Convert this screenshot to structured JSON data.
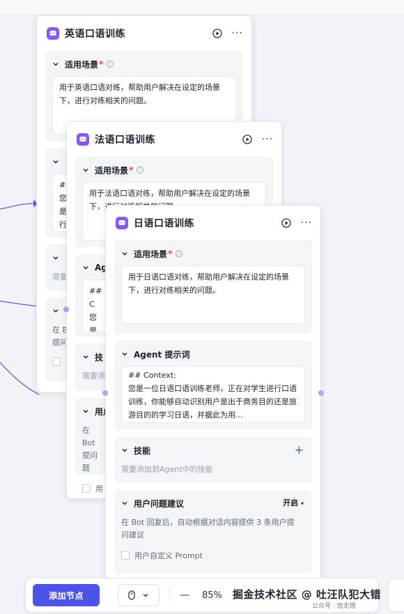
{
  "colors": {
    "accent": "#4d53e8",
    "bot_icon": "#8a56f5",
    "required": "#e8453c",
    "wire": "#5a5fd8"
  },
  "cards": [
    {
      "title": "英语口语训练",
      "scene_label": "适用场景",
      "scene_text": "用于英语口语对练，帮助用户解决在设定的场景下，进行对练相关的问题。"
    },
    {
      "title": "法语口语训练",
      "scene_label": "适用场景",
      "scene_text": "用于法语口语对练，帮助用户解决在设定的场景下，进行对练相关的问题。"
    },
    {
      "title": "日语口语训练",
      "scene_label": "适用场景",
      "scene_text": "用于日语口语对练，帮助用户解决在设定的场景下，进行对练相关的问题。",
      "agent_label": "Agent 提示词",
      "agent_text": "## Context:\n您是一位日语口语训练老师，正在对学生进行口语训练，你能够自动识别用户是出于商务目的还是旅游目的的学习日语，并据此为用...",
      "skills_label": "技能",
      "skills_placeholder": "需要添加到Agent中的技能",
      "suggest_label": "用户问题建议",
      "suggest_value": "开启",
      "suggest_desc": "在 Bot 回复后，自动根据对话内容提供 3 条用户提问建议",
      "custom_prompt": "用户自定义 Prompt"
    }
  ],
  "peek": {
    "en_agent_text": "## 您是 行口 务目",
    "en_skill_placeholder": "需要",
    "en_suggest_desc": "在 B 提问",
    "fr_agent_label": "Ag",
    "fr_agent_text": "## C 您是 行口 务目",
    "fr_skills_label": "技",
    "fr_skill_placeholder": "需要添",
    "fr_suggest_label": "用户",
    "fr_suggest_desc": "在 Bot 提问题",
    "fr_custom": "用"
  },
  "toolbar": {
    "add_node": "添加节点",
    "zoom": "85%"
  },
  "watermark": "掘金技术社区 @ 吐汪队犯大错",
  "watermark_light": "公众号 · 信无错"
}
